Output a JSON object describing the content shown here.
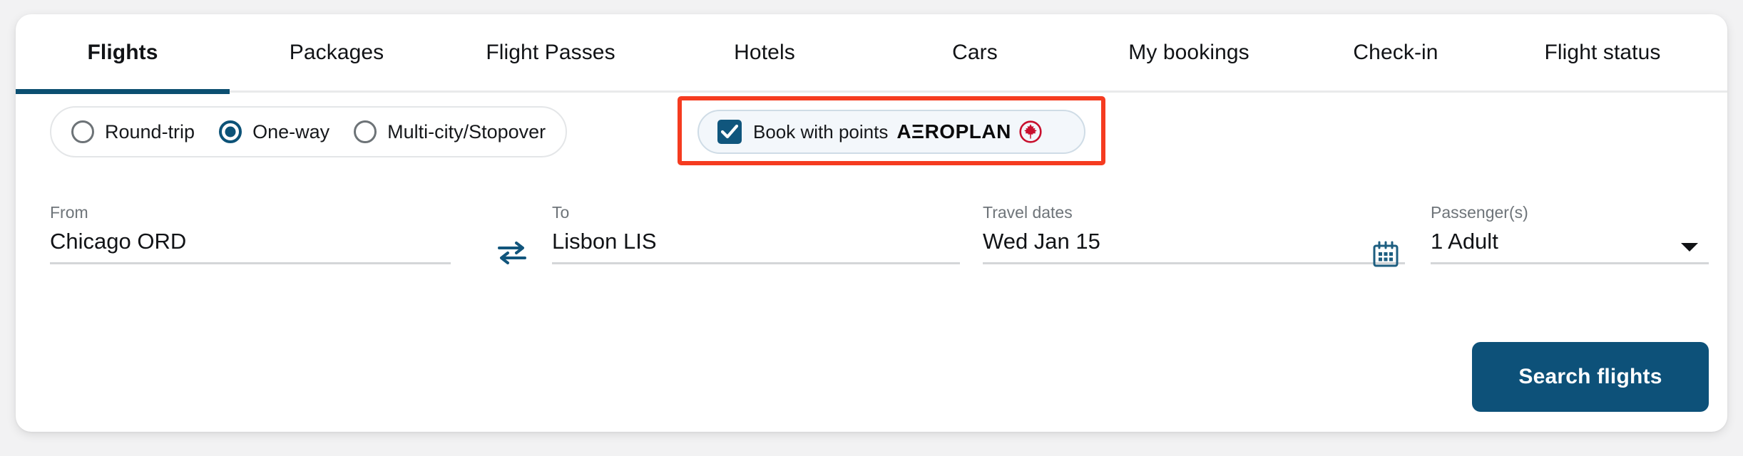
{
  "tabs": [
    {
      "label": "Flights",
      "active": true
    },
    {
      "label": "Packages",
      "active": false
    },
    {
      "label": "Flight Passes",
      "active": false
    },
    {
      "label": "Hotels",
      "active": false
    },
    {
      "label": "Cars",
      "active": false
    },
    {
      "label": "My bookings",
      "active": false
    },
    {
      "label": "Check-in",
      "active": false
    },
    {
      "label": "Flight status",
      "active": false
    }
  ],
  "trip_type": {
    "options": [
      {
        "label": "Round-trip",
        "selected": false
      },
      {
        "label": "One-way",
        "selected": true
      },
      {
        "label": "Multi-city/Stopover",
        "selected": false
      }
    ]
  },
  "book_with_points": {
    "label": "Book with points",
    "brand": "AΞROPLAN",
    "checked": true,
    "icon": "air-canada-roundel-icon",
    "highlighted": true,
    "highlight_color": "#f53b20"
  },
  "fields": {
    "from": {
      "label": "From",
      "value": "Chicago ORD"
    },
    "to": {
      "label": "To",
      "value": "Lisbon LIS"
    },
    "dates": {
      "label": "Travel dates",
      "value": "Wed Jan 15"
    },
    "passengers": {
      "label": "Passenger(s)",
      "value": "1 Adult"
    }
  },
  "icons": {
    "swap": "swap-horizontal-icon",
    "calendar": "calendar-icon",
    "caret": "chevron-down-icon",
    "check": "check-icon"
  },
  "search_button": {
    "label": "Search flights"
  },
  "colors": {
    "accent": "#0c5277",
    "button": "#0d5179",
    "highlight": "#f53b20",
    "maple_red": "#c8102e",
    "page_bg": "#f2f2f3"
  }
}
